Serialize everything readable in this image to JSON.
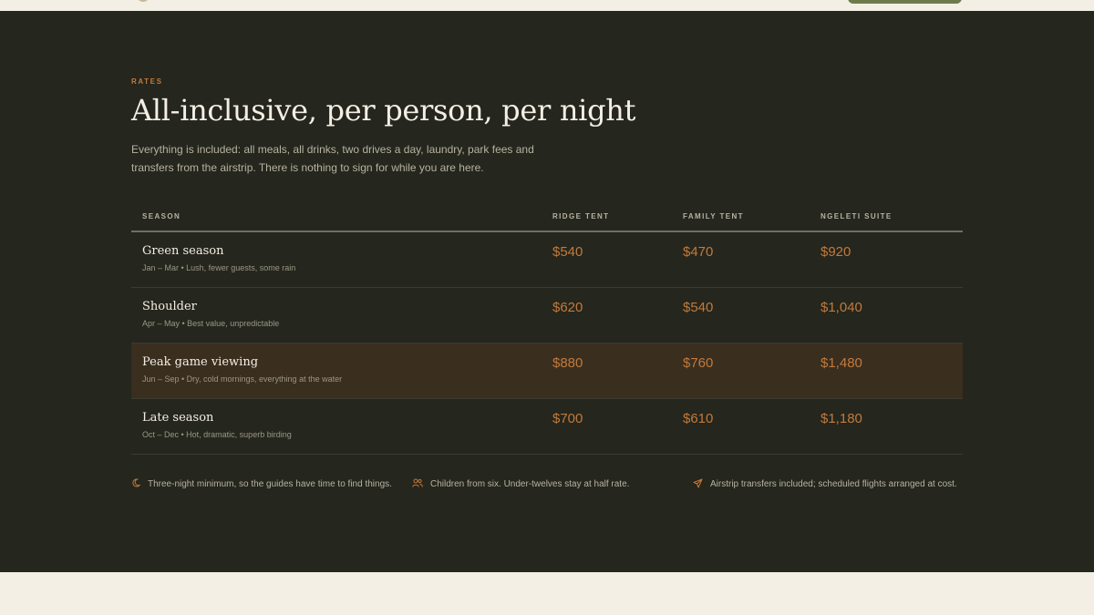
{
  "section": {
    "eyebrow": "RATES",
    "heading": "All-inclusive, per person, per night",
    "intro": "Everything is included: all meals, all drinks, two drives a day, laundry, park fees and transfers from the airstrip. There is nothing to sign for while you are here."
  },
  "table": {
    "headers": [
      "SEASON",
      "RIDGE TENT",
      "FAMILY TENT",
      "NGELETI SUITE"
    ],
    "rows": [
      {
        "name": "Green season",
        "note": "Jan – Mar • Lush, fewer guests, some rain",
        "ridge": "$540",
        "family": "$470",
        "suite": "$920",
        "highlight": false
      },
      {
        "name": "Shoulder",
        "note": "Apr – May • Best value, unpredictable",
        "ridge": "$620",
        "family": "$540",
        "suite": "$1,040",
        "highlight": false
      },
      {
        "name": "Peak game viewing",
        "note": "Jun – Sep • Dry, cold mornings, everything at the water",
        "ridge": "$880",
        "family": "$760",
        "suite": "$1,480",
        "highlight": true
      },
      {
        "name": "Late season",
        "note": "Oct – Dec • Hot, dramatic, superb birding",
        "ridge": "$700",
        "family": "$610",
        "suite": "$1,180",
        "highlight": false
      }
    ]
  },
  "notes": [
    {
      "icon": "moon-icon",
      "text": "Three-night minimum, so the guides have time to find things."
    },
    {
      "icon": "users-icon",
      "text": "Children from six. Under-twelves stay at half rate."
    },
    {
      "icon": "plane-icon",
      "text": "Airstrip transfers included; scheduled flights arranged at cost."
    }
  ],
  "colors": {
    "section_bg": "#25261d",
    "accent": "#c27a3c",
    "highlight_row": "#3a2e1f",
    "page_bg": "#f3efe5",
    "nav_button": "#6e7a4c"
  }
}
